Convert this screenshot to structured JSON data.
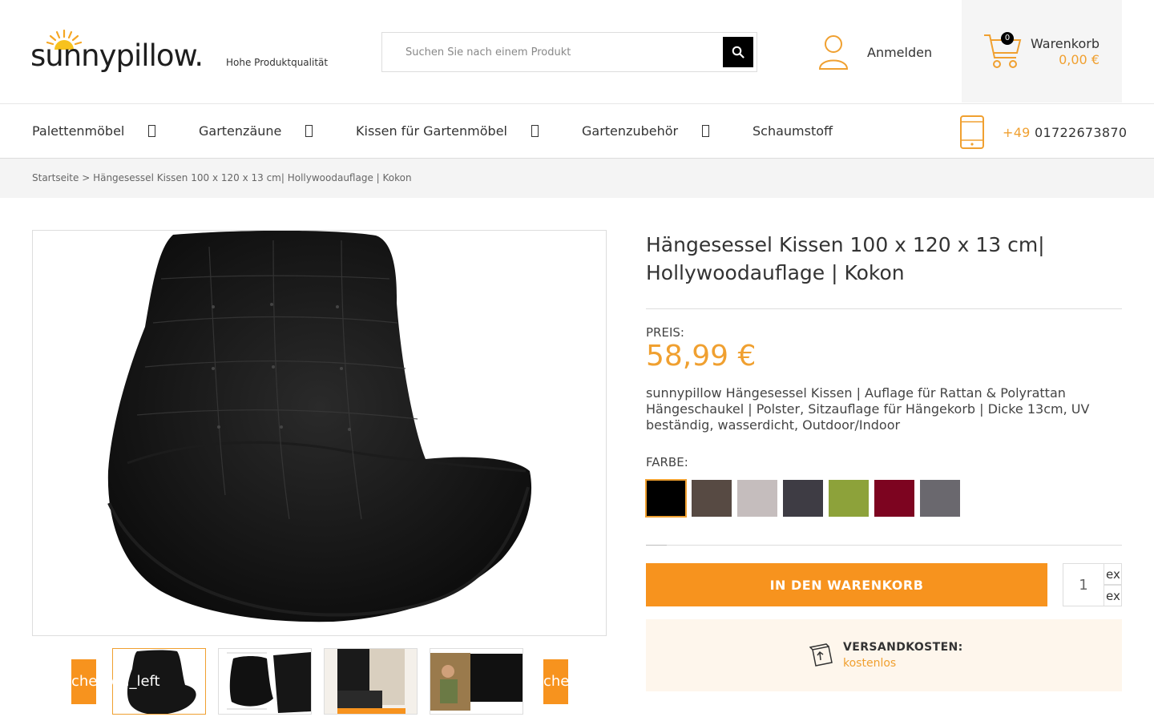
{
  "header": {
    "logo_text": "sunnypillow.",
    "logo_tagline": "Hohe Produktqualität",
    "search_placeholder": "Suchen Sie nach einem Produkt",
    "account_label": "Anmelden",
    "cart_title": "Warenkorb",
    "cart_total": "0,00 €",
    "cart_count": "0"
  },
  "nav": {
    "items": [
      {
        "label": "Palettenmöbel"
      },
      {
        "label": "Gartenzäune"
      },
      {
        "label": "Kissen für Gartenmöbel"
      },
      {
        "label": "Gartenzubehör"
      },
      {
        "label": "Schaumstoff"
      }
    ],
    "phone_prefix": "+49",
    "phone_number": " 01722673870"
  },
  "breadcrumb": {
    "home": "Startseite",
    "separator": " > ",
    "current": "Hängesessel Kissen 100 x 120 x 13 cm| Hollywoodauflage | Kokon"
  },
  "gallery": {
    "prev_label": "chevron_left",
    "next_label": "chevron_right",
    "thumb_count": 4
  },
  "product": {
    "title": "Hängesessel Kissen 100 x 120 x 13 cm| Hollywoodauflage | Kokon",
    "price_label": "PREIS:",
    "price": "58,99 €",
    "description": "sunnypillow Hängesessel Kissen | Auflage für Rattan & Polyrattan Hängeschaukel | Polster, Sitzauflage für Hängekorb | Dicke 13cm, UV beständig, wasserdicht, Outdoor/Indoor",
    "color_label": "FARBE:",
    "colors": [
      "#000000",
      "#574a43",
      "#c5bdbd",
      "#3e3c44",
      "#8da23a",
      "#7d0420",
      "#6a686e"
    ],
    "selected_color_index": 0,
    "add_to_cart_label": "IN DEN WARENKORB",
    "quantity": "1",
    "qty_up_label": "expand_less",
    "qty_down_label": "expand_more",
    "shipping_label": "VERSANDKOSTEN:",
    "shipping_value": "kostenlos"
  },
  "colors": {
    "accent": "#f7931e",
    "price": "#f0a030"
  }
}
